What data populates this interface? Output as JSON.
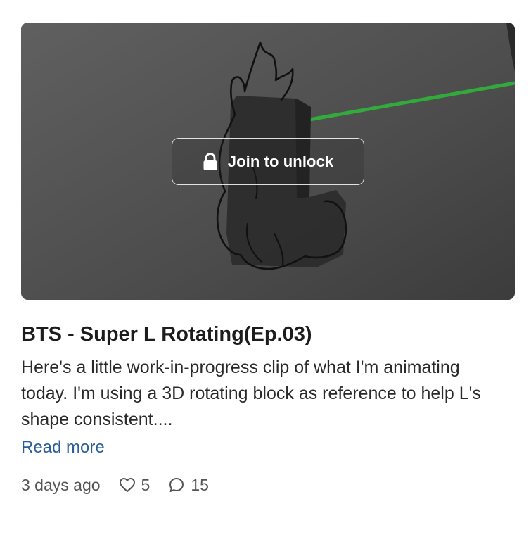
{
  "post": {
    "unlock_label": "Join to unlock",
    "title": "BTS - Super L Rotating(Ep.03)",
    "description": "Here's a little work-in-progress clip of what I'm animating today. I'm using a 3D rotating block as reference to help L's shape consistent....",
    "read_more": "Read more",
    "posted": "3 days ago",
    "likes": "5",
    "comments": "15"
  },
  "icons": {
    "lock": "lock-icon",
    "like": "heart-icon",
    "comment": "comment-icon"
  },
  "colors": {
    "link": "#2b5d9a",
    "laser": "#2fb53a"
  }
}
